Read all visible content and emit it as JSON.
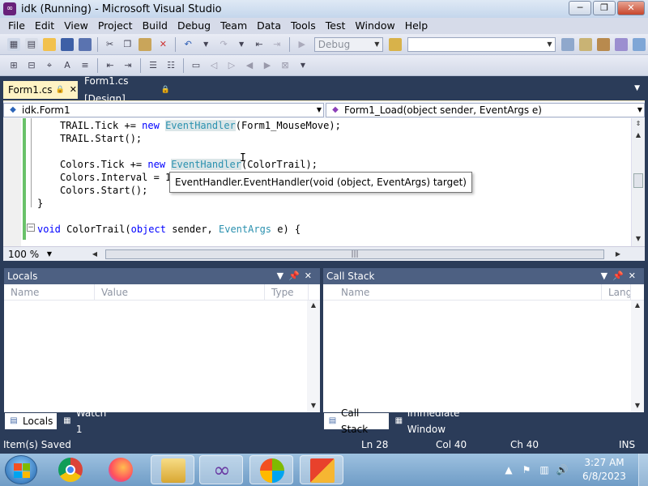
{
  "window": {
    "title": "idk (Running) - Microsoft Visual Studio",
    "minimize": "─",
    "maximize": "❐",
    "close": "✕"
  },
  "menu": [
    "File",
    "Edit",
    "View",
    "Project",
    "Build",
    "Debug",
    "Team",
    "Data",
    "Tools",
    "Test",
    "Window",
    "Help"
  ],
  "toolbar": {
    "config_combo": "Debug",
    "find_combo": ""
  },
  "tabs": {
    "active": "Form1.cs",
    "inactive": "Form1.cs [Design]"
  },
  "nav": {
    "type_combo": "idk.Form1",
    "member_combo": "Form1_Load(object sender, EventArgs e)"
  },
  "code": {
    "line1": [
      "TRAIL.Tick += ",
      "new",
      " ",
      "EventHandler",
      "(Form1_MouseMove);"
    ],
    "line2": "TRAIL.Start();",
    "line3": [
      "Colors.Tick += ",
      "new",
      " ",
      "EventHandler",
      "(ColorTrail);"
    ],
    "line4": "Colors.Interval = 1",
    "line5": "Colors.Start();",
    "line6": "}",
    "line8": [
      "void",
      " ColorTrail(",
      "object",
      " sender, ",
      "EventArgs",
      " e) {"
    ]
  },
  "tooltip": "EventHandler.EventHandler(void (object, EventArgs) target)",
  "zoom": "100 %",
  "locals_panel": {
    "title": "Locals",
    "columns": [
      "Name",
      "Value",
      "Type"
    ]
  },
  "callstack_panel": {
    "title": "Call Stack",
    "columns": [
      "Name",
      "Lang"
    ]
  },
  "bottom_tabs": {
    "locals": "Locals",
    "watch": "Watch 1",
    "callstack": "Call Stack",
    "immediate": "Immediate Window"
  },
  "status": {
    "message": "Item(s) Saved",
    "line": "Ln 28",
    "col": "Col 40",
    "ch": "Ch 40",
    "mode": "INS"
  },
  "clock": {
    "time": "3:27 AM",
    "date": "6/8/2023"
  },
  "colors": {
    "chrome": "#2b3c59",
    "active_tab": "#fff3c4",
    "keyword": "#0000ff",
    "type": "#2b91af"
  }
}
